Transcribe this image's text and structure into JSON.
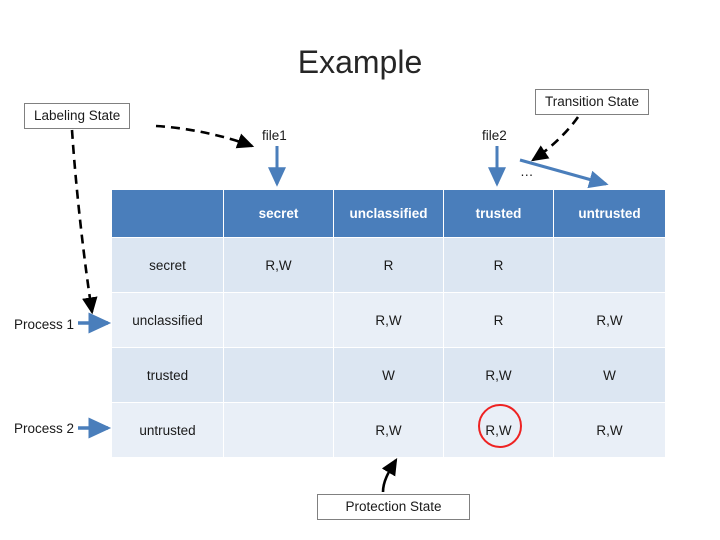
{
  "title": "Example",
  "callouts": {
    "labeling_state": "Labeling State",
    "transition_state": "Transition State",
    "protection_state": "Protection State"
  },
  "column_labels": {
    "file1": "file1",
    "file2": "file2",
    "ellipsis": "…"
  },
  "process_labels": {
    "process1": "Process 1",
    "process2": "Process 2"
  },
  "matrix": {
    "headers": [
      "",
      "secret",
      "unclassified",
      "trusted",
      "untrusted"
    ],
    "rows": [
      {
        "label": "secret",
        "cells": [
          "R,W",
          "R",
          "R",
          ""
        ]
      },
      {
        "label": "unclassified",
        "cells": [
          "",
          "R,W",
          "R",
          "R,W"
        ]
      },
      {
        "label": "trusted",
        "cells": [
          "",
          "W",
          "R,W",
          "W"
        ]
      },
      {
        "label": "untrusted",
        "cells": [
          "",
          "R,W",
          "R,W",
          "R,W"
        ]
      }
    ]
  },
  "colors": {
    "header_blue": "#4a7ebb",
    "cell_light": "#e9eff7",
    "cell_alt": "#dce6f2",
    "highlight_red": "#ee2222",
    "arrow_blue": "#4a7ebb",
    "arrow_black": "#000000"
  }
}
